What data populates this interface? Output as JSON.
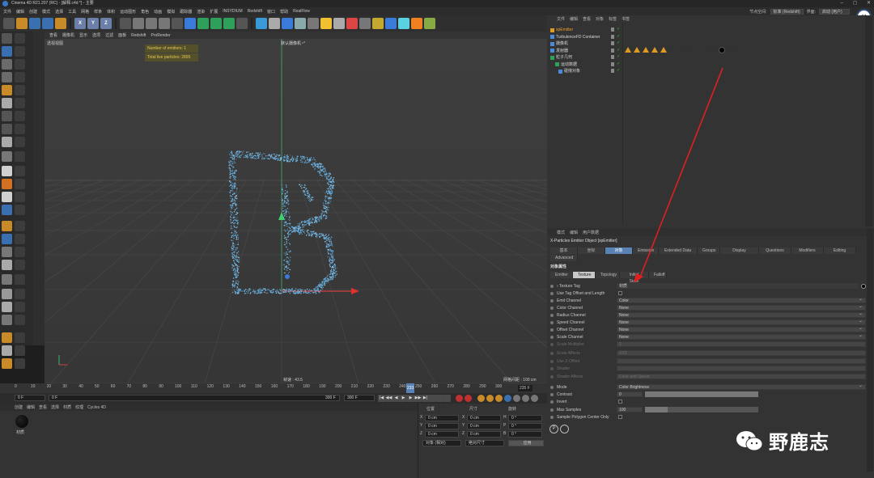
{
  "window": {
    "title": "Cinema 4D R21.207 (RC) - [解释.c4d *] - 主要",
    "buttons": [
      "–",
      "◻",
      "✕"
    ]
  },
  "menu": [
    "文件",
    "编辑",
    "创建",
    "模式",
    "选择",
    "工具",
    "网格",
    "样条",
    "体积",
    "运动图形",
    "角色",
    "动画",
    "模拟",
    "跟踪器",
    "渲染",
    "扩展",
    "INSYDIUM",
    "Redshift",
    "窗口",
    "帮助",
    "RealFlow"
  ],
  "right_menu": {
    "layout_label": "节点空间:",
    "layout_value": "标准 (Redshift)",
    "interface_label": "界面:",
    "interface_value": "启动 (用户)"
  },
  "toolbar": {
    "axes": [
      "X",
      "Y",
      "Z"
    ]
  },
  "viewport": {
    "menu": [
      "查看",
      "摄像机",
      "显示",
      "选项",
      "过滤",
      "面板",
      "Redshift",
      "ProRender"
    ],
    "view_name": "透视视图",
    "camera_label": "默认摄像机 ⁿ°",
    "hud_emitters": "Number of emitters: 1",
    "hud_particles": "Total live particles: 2895",
    "fps": "帧速 : 43.5",
    "grid": "网格间距 : 100 cm"
  },
  "timeline": {
    "ticks": [
      "0",
      "10",
      "20",
      "30",
      "40",
      "50",
      "60",
      "70",
      "80",
      "90",
      "100",
      "110",
      "120",
      "130",
      "140",
      "150",
      "160",
      "170",
      "180",
      "190",
      "200",
      "210",
      "220",
      "230",
      "240",
      "250",
      "260",
      "270",
      "280",
      "290",
      "300"
    ],
    "current": "233",
    "current_frame": "235 F",
    "start": "0 F",
    "start2": "0 F",
    "end": "300 F",
    "end2": "300 F"
  },
  "materials": {
    "menu": [
      "创建",
      "编辑",
      "查看",
      "选择",
      "材质",
      "纹理",
      "Cycles 4D"
    ],
    "item": "材质"
  },
  "coords": {
    "headers": [
      "位置",
      "尺寸",
      "旋转"
    ],
    "rows": [
      {
        "a": "X",
        "pv": "0 cm",
        "b": "X",
        "sv": "0 cm",
        "c": "H",
        "rv": "0 °"
      },
      {
        "a": "Y",
        "pv": "0 cm",
        "b": "Y",
        "sv": "0 cm",
        "c": "P",
        "rv": "0 °"
      },
      {
        "a": "Z",
        "pv": "0 cm",
        "b": "Z",
        "sv": "0 cm",
        "c": "B",
        "rv": "0 °"
      }
    ],
    "mode": "对象 (相对)",
    "size_mode": "绝对尺寸",
    "apply": "应用"
  },
  "objects": {
    "menu": [
      "文件",
      "编辑",
      "查看",
      "对象",
      "标签",
      "书签"
    ],
    "rows": [
      {
        "name": "xpEmitter",
        "color": "#f0a030"
      },
      {
        "name": "TurbulenceFD Container",
        "color": "#d8d8d8"
      },
      {
        "name": "摄像机",
        "color": "#d8d8d8"
      },
      {
        "name": "发射器",
        "color": "#d8d8d8"
      },
      {
        "name": "粒子几何",
        "color": "#d8d8d8"
      },
      {
        "name": "运动数据",
        "color": "#d8d8d8"
      },
      {
        "name": "碰撞对象",
        "color": "#d8d8d8"
      }
    ]
  },
  "attributes": {
    "menu": [
      "模式",
      "编辑",
      "用户数据"
    ],
    "object_title": "X-Particles Emitter Object [xpEmitter]",
    "tabs1": [
      "基本",
      "坐标",
      "对象",
      "Emission",
      "Extended Data",
      "Groups",
      "Display",
      "Questions",
      "Modifiers",
      "Editing"
    ],
    "tabs1_active": "对象",
    "tab_advanced": "Advanced",
    "section": "对象属性",
    "tabs2": [
      "Emitter",
      "Texture",
      "Topology",
      "Initial State",
      "Falloff"
    ],
    "tabs2_active": "Texture",
    "props": [
      {
        "label": "› Texture Tag",
        "value": "材质",
        "type": "link"
      },
      {
        "label": "Use Tag Offset and Length",
        "value": "",
        "type": "check"
      },
      {
        "label": "Emit Channel",
        "value": "Color",
        "type": "drop"
      },
      {
        "label": "Color Channel",
        "value": "None",
        "type": "drop"
      },
      {
        "label": "Radius Channel",
        "value": "None",
        "type": "drop"
      },
      {
        "label": "Speed Channel",
        "value": "None",
        "type": "drop"
      },
      {
        "label": "Offset Channel",
        "value": "None",
        "type": "drop"
      },
      {
        "label": "Scale Channel",
        "value": "None",
        "type": "drop"
      },
      {
        "label": "Scale Multiplier",
        "value": "1",
        "type": "dim"
      },
      {
        "label": "Scale Affects",
        "value": "XYZ",
        "type": "dim"
      },
      {
        "label": "Use Z-Offset",
        "value": "",
        "type": "dim"
      },
      {
        "label": "Shader",
        "value": "",
        "type": "dim"
      },
      {
        "label": "Shader Affects",
        "value": "Color and Speed",
        "type": "dim"
      },
      {
        "label": "Mode",
        "value": "Color Brightness",
        "type": "drop"
      },
      {
        "label": "Contrast",
        "value": "0",
        "type": "slider"
      },
      {
        "label": "Invert",
        "value": "",
        "type": "check"
      },
      {
        "label": "Max Samples",
        "value": "100",
        "type": "slider"
      },
      {
        "label": "Sample Polygon Center Only",
        "value": "",
        "type": "check"
      }
    ]
  },
  "watermark": "野鹿志",
  "colors": {
    "accent": "#5a82b4",
    "arrow": "#e02020",
    "particles": "#5fa8d8"
  }
}
